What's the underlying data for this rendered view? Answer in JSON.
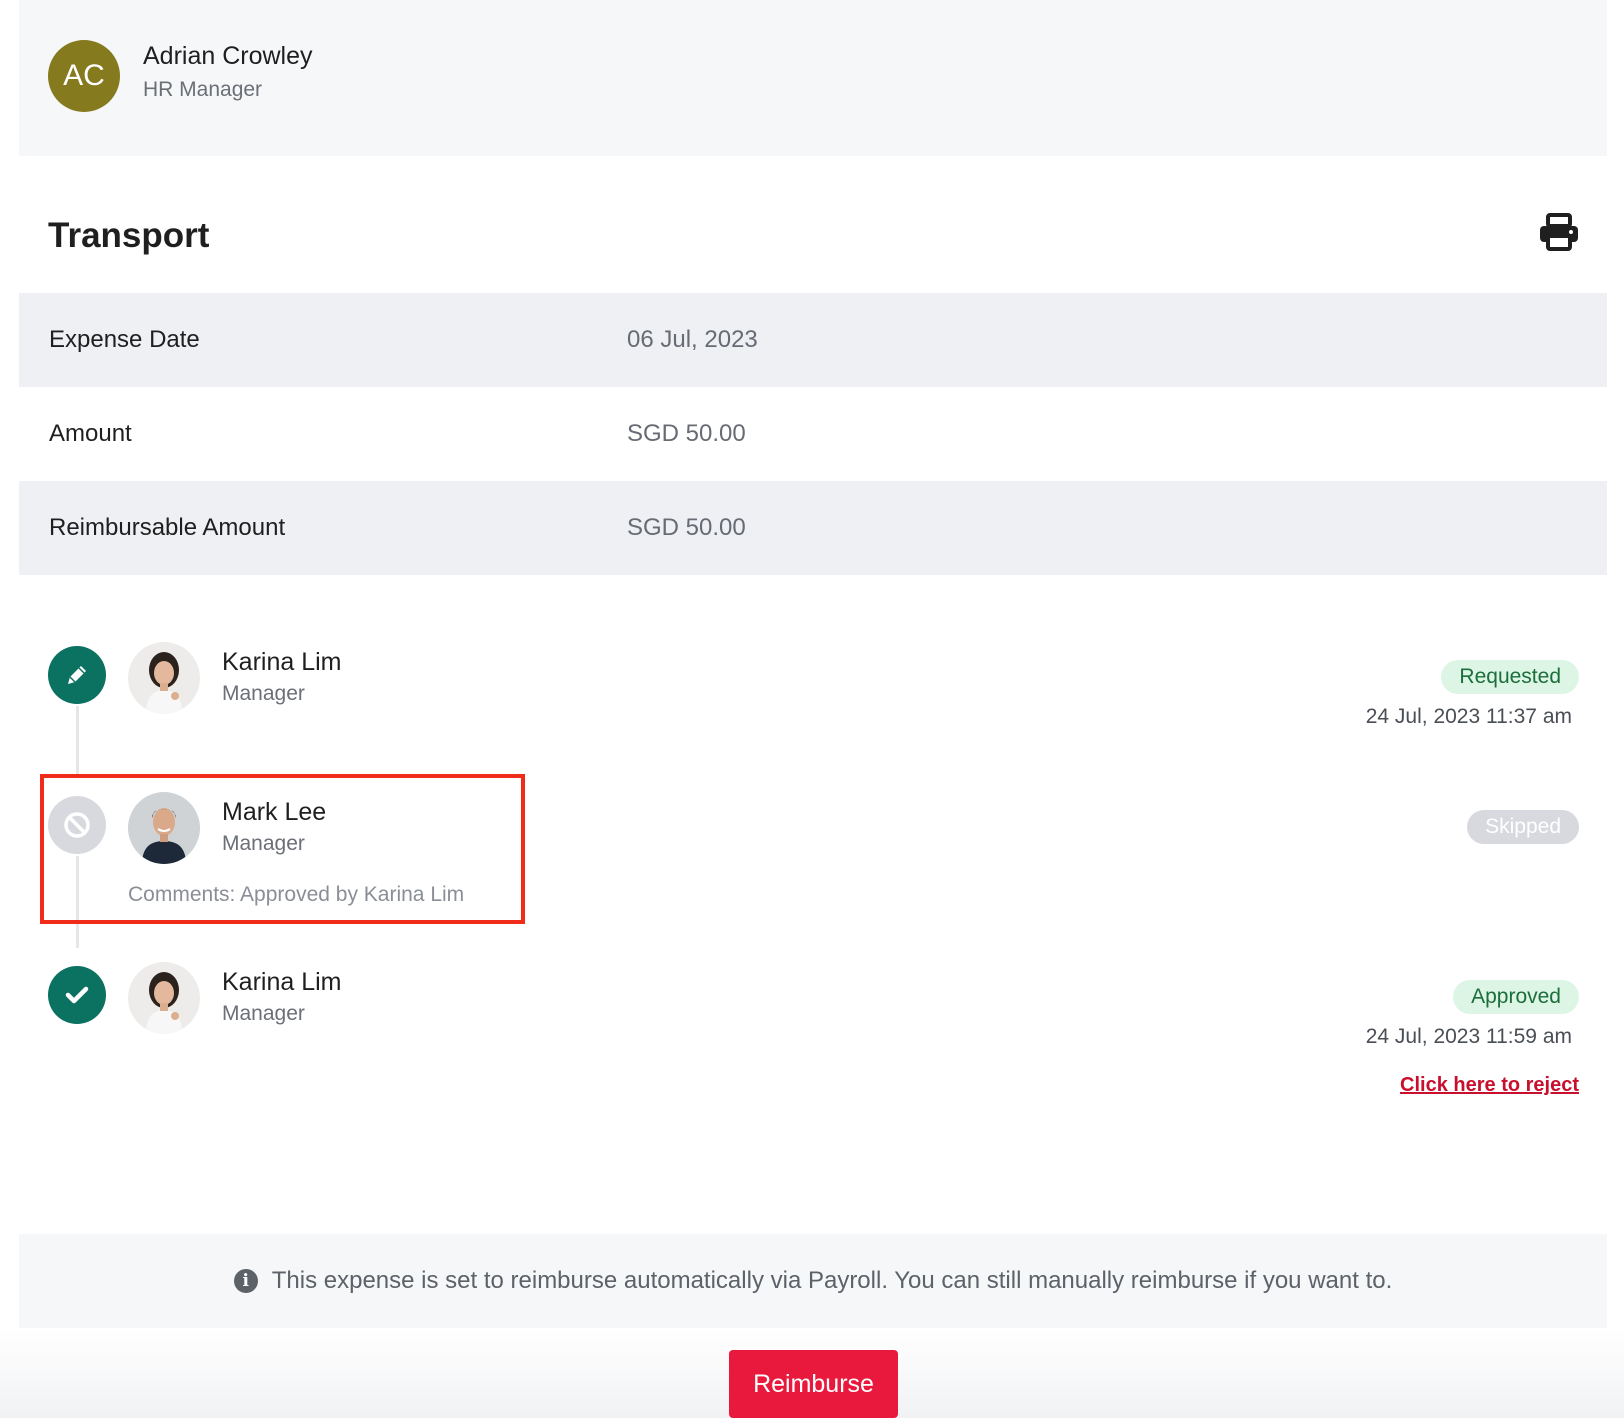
{
  "requester": {
    "initials": "AC",
    "name": "Adrian Crowley",
    "role": "HR Manager",
    "avatar_color": "#857a1e"
  },
  "title": "Transport",
  "toolbar": {
    "print_icon": "print-icon"
  },
  "details": [
    {
      "label": "Expense Date",
      "value": "06 Jul, 2023"
    },
    {
      "label": "Amount",
      "value": "SGD 50.00"
    },
    {
      "label": "Reimbursable Amount",
      "value": "SGD 50.00"
    }
  ],
  "timeline": [
    {
      "step_icon": "pencil-icon",
      "name": "Karina Lim",
      "role": "Manager",
      "status": "Requested",
      "timestamp": "24 Jul, 2023 11:37 am"
    },
    {
      "step_icon": "ban-icon",
      "name": "Mark Lee",
      "role": "Manager",
      "status": "Skipped",
      "comment": "Comments: Approved by Karina Lim"
    },
    {
      "step_icon": "check-icon",
      "name": "Karina Lim",
      "role": "Manager",
      "status": "Approved",
      "timestamp": "24 Jul, 2023 11:59 am",
      "action_link": "Click here to reject"
    }
  ],
  "info_banner": {
    "icon": "info-icon",
    "text": "This expense is set to reimburse automatically via Payroll. You can still manually reimburse if you want to."
  },
  "actions": {
    "reimburse_label": "Reimburse"
  },
  "colors": {
    "step_done": "#0b7262",
    "step_skipped": "#d7d9de",
    "badge_green_bg": "#dcf5e5",
    "badge_green_text": "#1c6e3b",
    "highlight": "#f12b1a",
    "reimburse_button": "#e8193c",
    "reject_link": "#c8102e"
  }
}
